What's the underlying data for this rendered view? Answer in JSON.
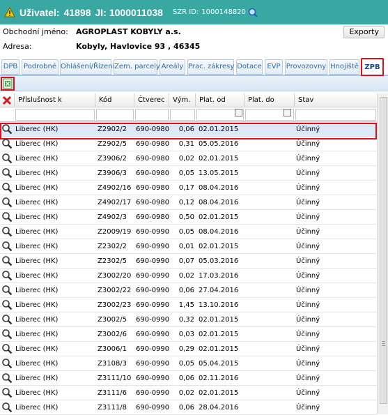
{
  "header": {
    "user_label": "Uživatel:",
    "user_id": "41898",
    "ji_label": "JI:",
    "ji_value": "1000011038",
    "szr_label": "SZR ID:",
    "szr_value": "1000148820",
    "icon": "search-refresh-icon"
  },
  "info": {
    "business_name_label": "Obchodní jméno:",
    "business_name": "AGROPLAST KOBYLY a.s.",
    "address_label": "Adresa:",
    "address": "Kobyly, Havlovice 93 , 46345",
    "export_label": "Exporty"
  },
  "tabs": [
    "DPB",
    "Podrobné",
    "Ohlášení/Řízení",
    "Zem. parcely",
    "Areály",
    "Prac. zákresy",
    "Dotace",
    "EVP",
    "Provozovny",
    "Hnojiště",
    "ZPB"
  ],
  "active_tab": "ZPB",
  "columns": [
    "Příslušnost k",
    "Kód",
    "Čtverec",
    "Vým.",
    "Plat. od",
    "Plat. do",
    "Stav"
  ],
  "rows": [
    [
      "Liberec (HK)",
      "Z2902/2",
      "690-0980",
      "0,06",
      "02.01.2015",
      "",
      "Účinný"
    ],
    [
      "Liberec (HK)",
      "Z2902/5",
      "690-0980",
      "0,31",
      "05.05.2016",
      "",
      "Účinný"
    ],
    [
      "Liberec (HK)",
      "Z3906/2",
      "690-0980",
      "0,02",
      "02.01.2015",
      "",
      "Účinný"
    ],
    [
      "Liberec (HK)",
      "Z3906/3",
      "690-0980",
      "0,05",
      "13.05.2015",
      "",
      "Účinný"
    ],
    [
      "Liberec (HK)",
      "Z4902/16",
      "690-0980",
      "0,17",
      "08.04.2016",
      "",
      "Účinný"
    ],
    [
      "Liberec (HK)",
      "Z4902/17",
      "690-0980",
      "0,12",
      "08.04.2016",
      "",
      "Účinný"
    ],
    [
      "Liberec (HK)",
      "Z4902/3",
      "690-0980",
      "0,50",
      "02.01.2015",
      "",
      "Účinný"
    ],
    [
      "Liberec (HK)",
      "Z2009/19",
      "690-0990",
      "0,05",
      "08.04.2016",
      "",
      "Účinný"
    ],
    [
      "Liberec (HK)",
      "Z2302/2",
      "690-0990",
      "0,01",
      "02.01.2015",
      "",
      "Účinný"
    ],
    [
      "Liberec (HK)",
      "Z2302/5",
      "690-0990",
      "0,07",
      "05.03.2016",
      "",
      "Účinný"
    ],
    [
      "Liberec (HK)",
      "Z3002/20",
      "690-0990",
      "0,02",
      "17.03.2016",
      "",
      "Účinný"
    ],
    [
      "Liberec (HK)",
      "Z3002/22",
      "690-0990",
      "0,06",
      "27.04.2016",
      "",
      "Účinný"
    ],
    [
      "Liberec (HK)",
      "Z3002/23",
      "690-0990",
      "1,45",
      "13.10.2016",
      "",
      "Účinný"
    ],
    [
      "Liberec (HK)",
      "Z3002/5",
      "690-0990",
      "0,32",
      "02.01.2015",
      "",
      "Účinný"
    ],
    [
      "Liberec (HK)",
      "Z3002/6",
      "690-0990",
      "0,03",
      "02.01.2015",
      "",
      "Účinný"
    ],
    [
      "Liberec (HK)",
      "Z3006/1",
      "690-0990",
      "0,29",
      "02.01.2015",
      "",
      "Účinný"
    ],
    [
      "Liberec (HK)",
      "Z3108/3",
      "690-0990",
      "0,05",
      "05.04.2015",
      "",
      "Účinný"
    ],
    [
      "Liberec (HK)",
      "Z3111/10",
      "690-0990",
      "0,06",
      "02.11.2016",
      "",
      "Účinný"
    ],
    [
      "Liberec (HK)",
      "Z3111/6",
      "690-0990",
      "0,02",
      "02.01.2015",
      "",
      "Účinný"
    ],
    [
      "Liberec (HK)",
      "Z3111/8",
      "690-0990",
      "0,06",
      "28.04.2016",
      "",
      "Účinný"
    ]
  ],
  "colors": {
    "header_bg": "#3aa8a2",
    "tab_text": "#2b6cb0",
    "highlight": "#e0101a",
    "selected_row": "#dde9f7"
  }
}
